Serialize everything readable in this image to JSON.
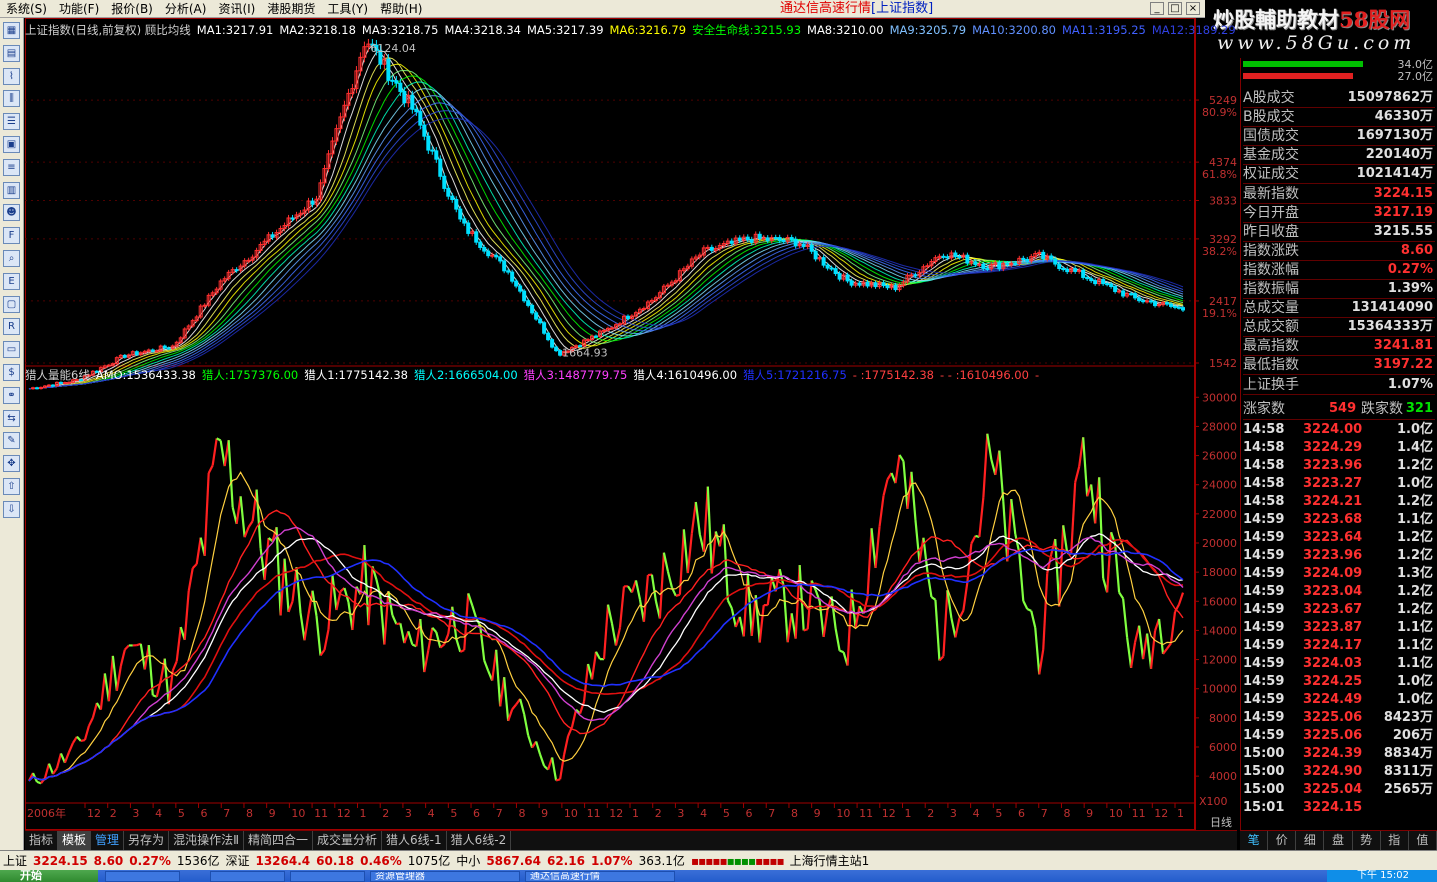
{
  "menubar": {
    "items": [
      "系统(S)",
      "功能(F)",
      "报价(B)",
      "分析(A)",
      "资讯(I)",
      "港股期货",
      "工具(Y)",
      "帮助(H)"
    ],
    "title_prefix": "通达信高速行情",
    "title_highlight": "[上证指数]"
  },
  "window_controls": [
    "_",
    "□",
    "×"
  ],
  "logo": {
    "line1_a": "炒股輔助教材",
    "line1_b": "58股网",
    "line2": "www.58Gu.com"
  },
  "toolbar": {
    "icons": [
      "grid-icon",
      "table-icon",
      "line-chart-icon",
      "candle-icon",
      "list-icon",
      "report-icon",
      "news-icon",
      "chart-icon",
      "people-icon",
      "f10-icon",
      "zoom-icon",
      "eft-icon",
      "window-icon",
      "rsi-icon",
      "monitor-icon",
      "dollar-icon",
      "link-icon",
      "export-icon",
      "pencil-icon",
      "move-icon",
      "up-arrow-icon",
      "down-arrow-icon"
    ],
    "labels": [
      "▦",
      "▤",
      "⌇",
      "⫼",
      "☰",
      "▣",
      "≡",
      "▥",
      "☻",
      "F",
      "⌕",
      "E",
      "▢",
      "R",
      "▭",
      "$",
      "⚭",
      "⇆",
      "✎",
      "✥",
      "⇧",
      "⇩"
    ]
  },
  "main_chart": {
    "legend": [
      {
        "text": "上证指数(日线,前复权) 顾比均线",
        "color": "#d0d0d0"
      },
      {
        "text": "MA1:3217.91",
        "color": "#ffffff"
      },
      {
        "text": "MA2:3218.18",
        "color": "#ffffff"
      },
      {
        "text": "MA3:3218.75",
        "color": "#ffffff"
      },
      {
        "text": "MA4:3218.34",
        "color": "#ffffff"
      },
      {
        "text": "MA5:3217.39",
        "color": "#ffffff"
      },
      {
        "text": "MA6:3216.79",
        "color": "#ffff00"
      },
      {
        "text": "安全生命线:3215.93",
        "color": "#00ff00"
      },
      {
        "text": "MA8:3210.00",
        "color": "#ffffff"
      },
      {
        "text": "MA9:3205.79",
        "color": "#80c0ff"
      },
      {
        "text": "MA10:3200.80",
        "color": "#6090ff"
      },
      {
        "text": "MA11:3195.25",
        "color": "#4060ff"
      },
      {
        "text": "MA12:3189.29",
        "color": "#3040e0"
      }
    ],
    "price_axis": [
      {
        "price": "5249",
        "pct": "80.9%"
      },
      {
        "price": "4374",
        "pct": "61.8%"
      },
      {
        "price": "3833",
        "pct": ""
      },
      {
        "price": "3292",
        "pct": "38.2%"
      },
      {
        "price": "2417",
        "pct": "19.1%"
      },
      {
        "price": "1542",
        "pct": ""
      }
    ],
    "high_label": "6124.04",
    "low_label": "1664.93"
  },
  "volume_chart": {
    "legend": [
      {
        "text": "猎人量能6线",
        "color": "#d0d0d0"
      },
      {
        "text": "AMO:1536433.38",
        "color": "#ffffff"
      },
      {
        "text": "猎人:1757376.00",
        "color": "#00ff00"
      },
      {
        "text": "猎人1:1775142.38",
        "color": "#ffffff"
      },
      {
        "text": "猎人2:1666504.00",
        "color": "#00ffff"
      },
      {
        "text": "猎人3:1487779.75",
        "color": "#ff40ff"
      },
      {
        "text": "猎人4:1610496.00",
        "color": "#ffffff"
      },
      {
        "text": "猎人5:1721216.75",
        "color": "#2030ff"
      },
      {
        "text": "- :1775142.38",
        "color": "#ff4040"
      },
      {
        "text": "- - :1610496.00",
        "color": "#ff4040"
      },
      {
        "text": "-",
        "color": "#ff4040"
      }
    ],
    "y_axis": [
      "30000",
      "28000",
      "26000",
      "24000",
      "22000",
      "20000",
      "18000",
      "16000",
      "14000",
      "12000",
      "10000",
      "8000",
      "6000",
      "4000"
    ],
    "multiplier": "X100"
  },
  "chart_data": [
    {
      "type": "line",
      "title": "上证指数(日线,前复权) 顾比均线",
      "ylabel": "",
      "ylim": [
        1542,
        6124
      ],
      "x": [
        "2006-01",
        "2006-04",
        "2006-07",
        "2006-10",
        "2007-01",
        "2007-04",
        "2007-07",
        "2007-10",
        "2008-01",
        "2008-04",
        "2008-07",
        "2008-10",
        "2009-01",
        "2009-04",
        "2009-07",
        "2009-10",
        "2010-01",
        "2010-04",
        "2010-07",
        "2010-10",
        "2011-01",
        "2011-04",
        "2011-07",
        "2011-10",
        "2012-01"
      ],
      "series": [
        {
          "name": "上证指数",
          "values": [
            1180,
            1300,
            1650,
            1780,
            2700,
            3300,
            3900,
            6124,
            5100,
            3500,
            2800,
            1665,
            2000,
            2450,
            3100,
            3300,
            3250,
            2700,
            2600,
            3100,
            2900,
            3050,
            2750,
            2450,
            2300
          ]
        }
      ],
      "annotations": [
        "6124.04",
        "1664.93"
      ]
    },
    {
      "type": "line",
      "title": "猎人量能6线",
      "ylabel": "",
      "ylim": [
        4000,
        30000
      ],
      "x": [
        "2006-01",
        "2006-04",
        "2006-07",
        "2006-10",
        "2007-01",
        "2007-04",
        "2007-07",
        "2007-10",
        "2008-01",
        "2008-04",
        "2008-07",
        "2008-10",
        "2009-01",
        "2009-04",
        "2009-07",
        "2009-10",
        "2010-01",
        "2010-04",
        "2010-07",
        "2010-10",
        "2011-01",
        "2011-04",
        "2011-07",
        "2011-10",
        "2012-01"
      ],
      "series": [
        {
          "name": "AMO",
          "values": [
            3500,
            5800,
            13000,
            10200,
            26000,
            19000,
            14500,
            17000,
            12500,
            15000,
            9200,
            4000,
            14000,
            16800,
            21500,
            15000,
            16000,
            13200,
            26200,
            13200,
            25000,
            13000,
            26000,
            12000,
            17000
          ]
        },
        {
          "name": "猎人5",
          "values": [
            3400,
            4300,
            8800,
            9600,
            16800,
            18500,
            16800,
            15800,
            13800,
            12600,
            10400,
            6800,
            9000,
            11500,
            14300,
            14000,
            14400,
            13800,
            16800,
            15400,
            16800,
            15200,
            17600,
            15600,
            16600
          ]
        }
      ]
    }
  ],
  "time_axis": {
    "first_label": "2006年",
    "months": [
      "12",
      "2",
      "3",
      "4",
      "5",
      "6",
      "7",
      "8",
      "9",
      "10",
      "11",
      "12",
      "1",
      "2",
      "3",
      "4",
      "5",
      "6",
      "7",
      "8",
      "9",
      "10",
      "11",
      "12",
      "1",
      "2",
      "3",
      "4",
      "5",
      "6",
      "7",
      "8",
      "9",
      "10",
      "11",
      "12",
      "1",
      "2",
      "3",
      "4",
      "5",
      "6",
      "7",
      "8",
      "9",
      "10",
      "11",
      "12",
      "1"
    ],
    "period": "日线"
  },
  "right_panel": {
    "top_bars": [
      {
        "value": "34.0亿",
        "color": "#00c000"
      },
      {
        "value": "27.0亿",
        "color": "#e02020"
      }
    ],
    "stats": [
      {
        "k": "A股成交",
        "v": "15097862万",
        "color": "#e0e0e0"
      },
      {
        "k": "B股成交",
        "v": "46330万",
        "color": "#e0e0e0"
      },
      {
        "k": "国债成交",
        "v": "1697130万",
        "color": "#e0e0e0"
      },
      {
        "k": "基金成交",
        "v": "220140万",
        "color": "#e0e0e0"
      },
      {
        "k": "权证成交",
        "v": "1021414万",
        "color": "#e0e0e0"
      },
      {
        "k": "最新指数",
        "v": "3224.15",
        "color": "#ff3030"
      },
      {
        "k": "今日开盘",
        "v": "3217.19",
        "color": "#ff3030"
      },
      {
        "k": "昨日收盘",
        "v": "3215.55",
        "color": "#e0e0e0"
      },
      {
        "k": "指数涨跌",
        "v": "8.60",
        "color": "#ff3030"
      },
      {
        "k": "指数涨幅",
        "v": "0.27%",
        "color": "#ff3030"
      },
      {
        "k": "指数振幅",
        "v": "1.39%",
        "color": "#e0e0e0"
      },
      {
        "k": "总成交量",
        "v": "131414090",
        "color": "#e0e0e0"
      },
      {
        "k": "总成交额",
        "v": "15364333万",
        "color": "#e0e0e0"
      },
      {
        "k": "最高指数",
        "v": "3241.81",
        "color": "#ff3030"
      },
      {
        "k": "最低指数",
        "v": "3197.22",
        "color": "#ff3030"
      },
      {
        "k": "上证换手",
        "v": "1.07%",
        "color": "#e0e0e0"
      }
    ],
    "breadth": {
      "up_label": "涨家数",
      "up": "549",
      "down_label": "跌家数",
      "down": "321"
    },
    "ticks": [
      {
        "t": "14:58",
        "p": "3224.00",
        "v": "1.0亿"
      },
      {
        "t": "14:58",
        "p": "3224.29",
        "v": "1.4亿"
      },
      {
        "t": "14:58",
        "p": "3223.96",
        "v": "1.2亿"
      },
      {
        "t": "14:58",
        "p": "3223.27",
        "v": "1.0亿"
      },
      {
        "t": "14:58",
        "p": "3224.21",
        "v": "1.2亿"
      },
      {
        "t": "14:59",
        "p": "3223.68",
        "v": "1.1亿"
      },
      {
        "t": "14:59",
        "p": "3223.64",
        "v": "1.2亿"
      },
      {
        "t": "14:59",
        "p": "3223.96",
        "v": "1.2亿"
      },
      {
        "t": "14:59",
        "p": "3224.09",
        "v": "1.3亿"
      },
      {
        "t": "14:59",
        "p": "3223.04",
        "v": "1.2亿"
      },
      {
        "t": "14:59",
        "p": "3223.67",
        "v": "1.2亿"
      },
      {
        "t": "14:59",
        "p": "3223.87",
        "v": "1.1亿"
      },
      {
        "t": "14:59",
        "p": "3224.17",
        "v": "1.1亿"
      },
      {
        "t": "14:59",
        "p": "3224.03",
        "v": "1.1亿"
      },
      {
        "t": "14:59",
        "p": "3224.25",
        "v": "1.0亿"
      },
      {
        "t": "14:59",
        "p": "3224.49",
        "v": "1.0亿"
      },
      {
        "t": "14:59",
        "p": "3225.06",
        "v": "8423万"
      },
      {
        "t": "14:59",
        "p": "3225.06",
        "v": "206万"
      },
      {
        "t": "15:00",
        "p": "3224.39",
        "v": "8834万"
      },
      {
        "t": "15:00",
        "p": "3224.90",
        "v": "8311万"
      },
      {
        "t": "15:00",
        "p": "3225.04",
        "v": "2565万"
      },
      {
        "t": "15:01",
        "p": "3224.15",
        "v": ""
      }
    ]
  },
  "bottom_tabs": [
    "指标",
    "模板",
    "管理",
    "另存为",
    "混沌操作法Ⅱ",
    "精简四合一",
    "成交量分析",
    "猎人6线-1",
    "猎人6线-2"
  ],
  "right_tabs": [
    "笔",
    "价",
    "细",
    "盘",
    "势",
    "指",
    "值"
  ],
  "statusbar": {
    "sh_label": "上证",
    "sh_price": "3224.15",
    "sh_chg": "8.60",
    "sh_pct": "0.27%",
    "sh_amt": "1536亿",
    "sz_label": "深证",
    "sz_price": "13264.4",
    "sz_chg": "60.18",
    "sz_pct": "0.46%",
    "sz_amt": "1075亿",
    "zx_label": "中小",
    "zx_price": "5867.64",
    "zx_chg": "62.16",
    "zx_pct": "1.07%",
    "zx_amt": "363.1亿",
    "server": "上海行情主站1"
  },
  "taskbar": {
    "start": "开始",
    "tasks": [
      "",
      "",
      "",
      "资源管理器",
      "通达信高速行情"
    ],
    "clock": "下午 15:02"
  }
}
